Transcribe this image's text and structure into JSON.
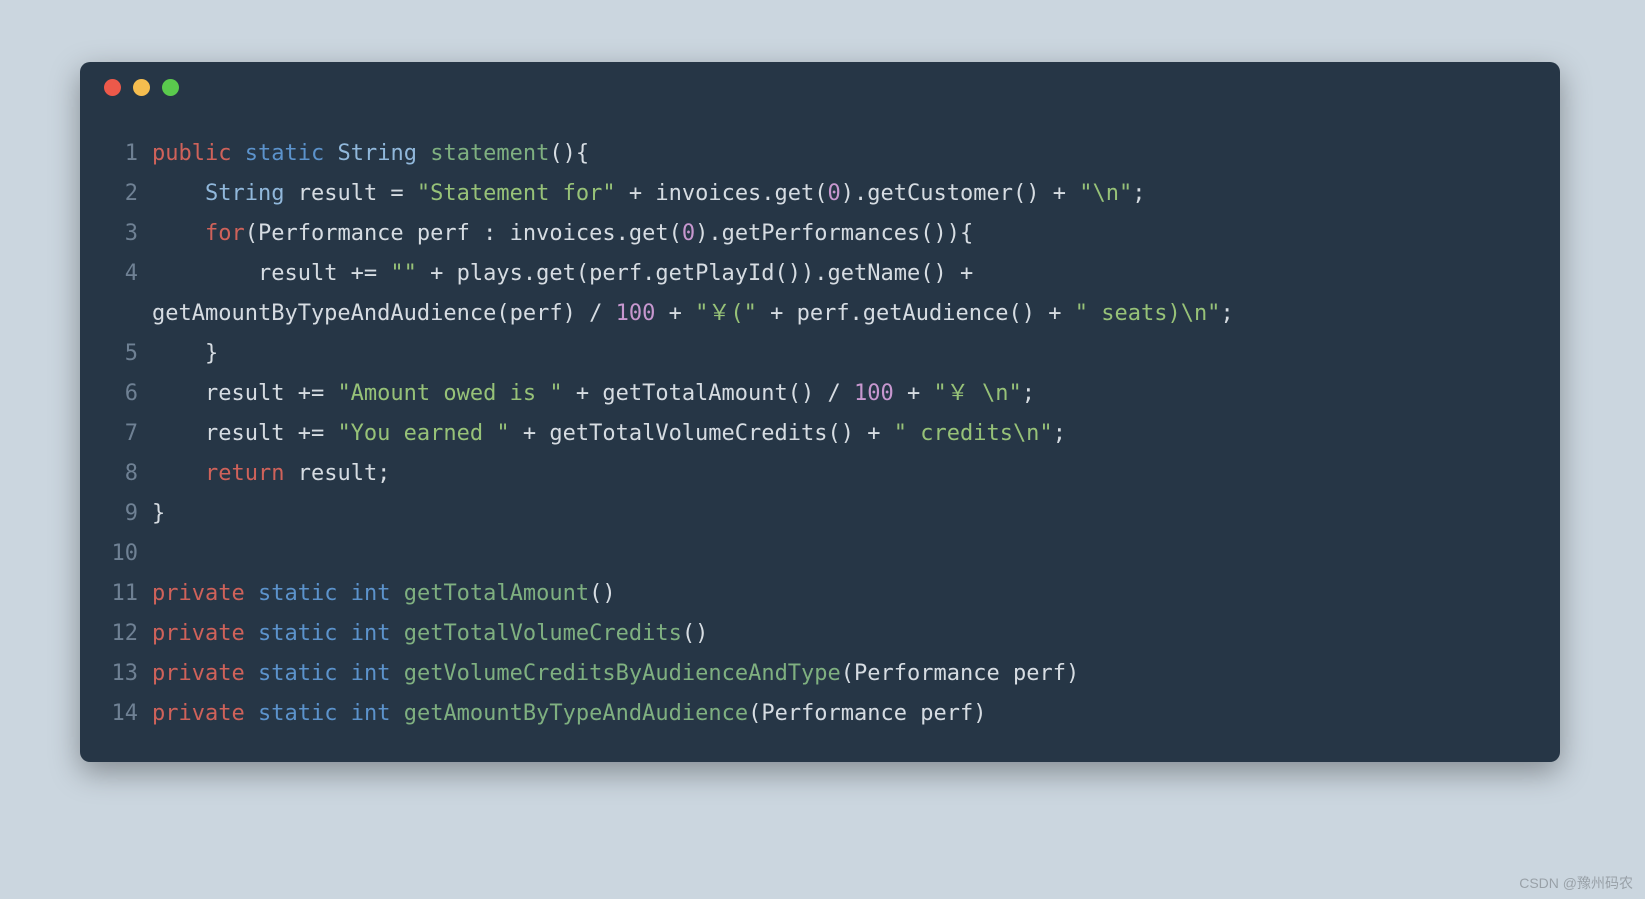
{
  "window": {
    "dots": [
      "red",
      "yellow",
      "green"
    ]
  },
  "code": {
    "lines": [
      {
        "n": "1",
        "tokens": [
          {
            "c": "kw-r",
            "t": "public"
          },
          {
            "t": " "
          },
          {
            "c": "kw-b",
            "t": "static"
          },
          {
            "t": " "
          },
          {
            "c": "ty",
            "t": "String"
          },
          {
            "t": " "
          },
          {
            "c": "fn",
            "t": "statement"
          },
          {
            "t": "(){"
          }
        ]
      },
      {
        "n": "2",
        "tokens": [
          {
            "t": "    "
          },
          {
            "c": "ty",
            "t": "String"
          },
          {
            "t": " result = "
          },
          {
            "c": "str",
            "t": "\"Statement for\""
          },
          {
            "t": " + invoices.get("
          },
          {
            "c": "num",
            "t": "0"
          },
          {
            "t": ").getCustomer() + "
          },
          {
            "c": "str",
            "t": "\"\\n\""
          },
          {
            "t": ";"
          }
        ]
      },
      {
        "n": "3",
        "tokens": [
          {
            "t": "    "
          },
          {
            "c": "kw-r",
            "t": "for"
          },
          {
            "t": "(Performance perf : invoices.get("
          },
          {
            "c": "num",
            "t": "0"
          },
          {
            "t": ").getPerformances()){"
          }
        ]
      },
      {
        "n": "4",
        "tokens": [
          {
            "t": "        result += "
          },
          {
            "c": "str",
            "t": "\"\""
          },
          {
            "t": " + plays.get(perf.getPlayId()).getName() + "
          }
        ],
        "wrap": [
          {
            "t": "getAmountByTypeAndAudience(perf) / "
          },
          {
            "c": "num",
            "t": "100"
          },
          {
            "t": " + "
          },
          {
            "c": "str",
            "t": "\"￥(\""
          },
          {
            "t": " + perf.getAudience() + "
          },
          {
            "c": "str",
            "t": "\" seats)\\n\""
          },
          {
            "t": ";"
          }
        ]
      },
      {
        "n": "5",
        "tokens": [
          {
            "t": "    }"
          }
        ]
      },
      {
        "n": "6",
        "tokens": [
          {
            "t": "    result += "
          },
          {
            "c": "str",
            "t": "\"Amount owed is \""
          },
          {
            "t": " + getTotalAmount() / "
          },
          {
            "c": "num",
            "t": "100"
          },
          {
            "t": " + "
          },
          {
            "c": "str",
            "t": "\"￥ \\n\""
          },
          {
            "t": ";"
          }
        ]
      },
      {
        "n": "7",
        "tokens": [
          {
            "t": "    result += "
          },
          {
            "c": "str",
            "t": "\"You earned \""
          },
          {
            "t": " + getTotalVolumeCredits() + "
          },
          {
            "c": "str",
            "t": "\" credits\\n\""
          },
          {
            "t": ";"
          }
        ]
      },
      {
        "n": "8",
        "tokens": [
          {
            "t": "    "
          },
          {
            "c": "kw-r",
            "t": "return"
          },
          {
            "t": " result;"
          }
        ]
      },
      {
        "n": "9",
        "tokens": [
          {
            "t": "}"
          }
        ]
      },
      {
        "n": "10",
        "tokens": [
          {
            "t": ""
          }
        ]
      },
      {
        "n": "11",
        "tokens": [
          {
            "c": "kw-r",
            "t": "private"
          },
          {
            "t": " "
          },
          {
            "c": "kw-b",
            "t": "static"
          },
          {
            "t": " "
          },
          {
            "c": "kw-b",
            "t": "int"
          },
          {
            "t": " "
          },
          {
            "c": "fn",
            "t": "getTotalAmount"
          },
          {
            "t": "()"
          }
        ]
      },
      {
        "n": "12",
        "tokens": [
          {
            "c": "kw-r",
            "t": "private"
          },
          {
            "t": " "
          },
          {
            "c": "kw-b",
            "t": "static"
          },
          {
            "t": " "
          },
          {
            "c": "kw-b",
            "t": "int"
          },
          {
            "t": " "
          },
          {
            "c": "fn",
            "t": "getTotalVolumeCredits"
          },
          {
            "t": "()"
          }
        ]
      },
      {
        "n": "13",
        "tokens": [
          {
            "c": "kw-r",
            "t": "private"
          },
          {
            "t": " "
          },
          {
            "c": "kw-b",
            "t": "static"
          },
          {
            "t": " "
          },
          {
            "c": "kw-b",
            "t": "int"
          },
          {
            "t": " "
          },
          {
            "c": "fn",
            "t": "getVolumeCreditsByAudienceAndType"
          },
          {
            "t": "(Performance perf)"
          }
        ]
      },
      {
        "n": "14",
        "tokens": [
          {
            "c": "kw-r",
            "t": "private"
          },
          {
            "t": " "
          },
          {
            "c": "kw-b",
            "t": "static"
          },
          {
            "t": " "
          },
          {
            "c": "kw-b",
            "t": "int"
          },
          {
            "t": " "
          },
          {
            "c": "fn",
            "t": "getAmountByTypeAndAudience"
          },
          {
            "t": "(Performance perf)"
          }
        ]
      }
    ]
  },
  "watermark": "CSDN @豫州码农"
}
